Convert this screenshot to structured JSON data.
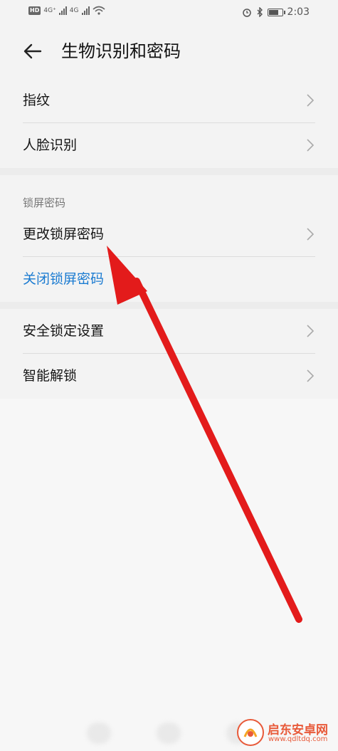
{
  "status_bar": {
    "hd_badge": "HD",
    "network_1": "4G⁺",
    "network_2": "4G",
    "time": "2:03",
    "battery_level": 0.8
  },
  "header": {
    "title": "生物识别和密码"
  },
  "groups": [
    {
      "items": [
        {
          "label": "指纹"
        },
        {
          "label": "人脸识别"
        }
      ]
    },
    {
      "section_label": "锁屏密码",
      "items": [
        {
          "label": "更改锁屏密码"
        },
        {
          "label": "关闭锁屏密码"
        }
      ]
    },
    {
      "items": [
        {
          "label": "安全锁定设置"
        },
        {
          "label": "智能解锁"
        }
      ]
    }
  ],
  "colors": {
    "link_blue": "#1b7bd1",
    "annotation_red": "#e31b1b",
    "background": "#f3f3f3"
  },
  "watermark": {
    "name": "启东安卓网",
    "url": "www.qdltdq.com"
  },
  "icons": {
    "back": "arrow-left-icon",
    "chevron": "chevron-right-icon",
    "alarm": "alarm-icon",
    "bluetooth": "bluetooth-icon",
    "battery": "battery-icon",
    "wifi": "wifi-icon"
  }
}
